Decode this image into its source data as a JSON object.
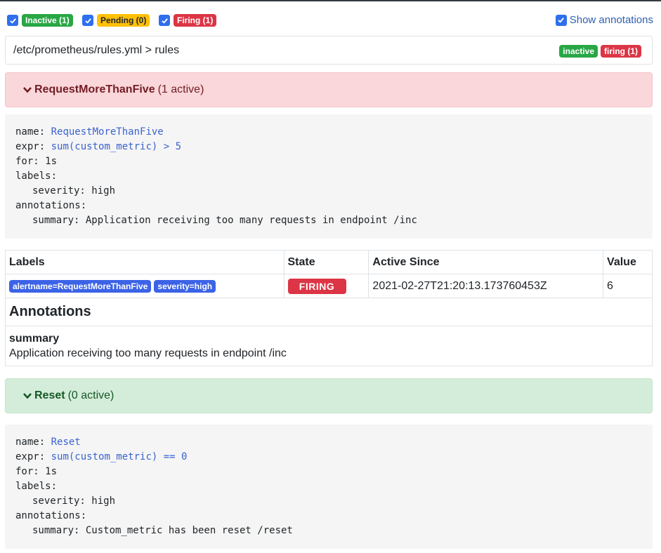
{
  "filters": {
    "inactive": {
      "label": "Inactive (1)",
      "color": "#28a745"
    },
    "pending": {
      "label": "Pending (0)",
      "color": "#ffc107"
    },
    "firing": {
      "label": "Firing (1)",
      "color": "#dc3545"
    },
    "show_annotations": "Show annotations"
  },
  "file": {
    "path": "/etc/prometheus/rules.yml > rules",
    "badge_inactive": "inactive",
    "badge_firing": "firing (1)"
  },
  "groups": [
    {
      "name": "RequestMoreThanFive",
      "count": "(1 active)",
      "rule": {
        "name_key": "name:",
        "name_val": "RequestMoreThanFive",
        "expr_key": "expr:",
        "expr_val": "sum(custom_metric) > 5",
        "for_line": "for: 1s",
        "labels_key": "labels:",
        "label_line": "severity: high",
        "annotations_key": "annotations:",
        "annotation_line": "summary: Application receiving too many requests in endpoint /inc"
      },
      "table": {
        "headers": [
          "Labels",
          "State",
          "Active Since",
          "Value"
        ],
        "row": {
          "labels": [
            "alertname=RequestMoreThanFive",
            "severity=high"
          ],
          "state": "FIRING",
          "active_since": "2021-02-27T21:20:13.173760453Z",
          "value": "6"
        },
        "annotations_title": "Annotations",
        "annotation_key": "summary",
        "annotation_value": "Application receiving too many requests in endpoint /inc"
      }
    },
    {
      "name": "Reset",
      "count": "(0 active)",
      "rule": {
        "name_key": "name:",
        "name_val": "Reset",
        "expr_key": "expr:",
        "expr_val": "sum(custom_metric) == 0",
        "for_line": "for: 1s",
        "labels_key": "labels:",
        "label_line": "severity: high",
        "annotations_key": "annotations:",
        "annotation_line": "summary: Custom_metric has been reset /reset"
      }
    }
  ]
}
